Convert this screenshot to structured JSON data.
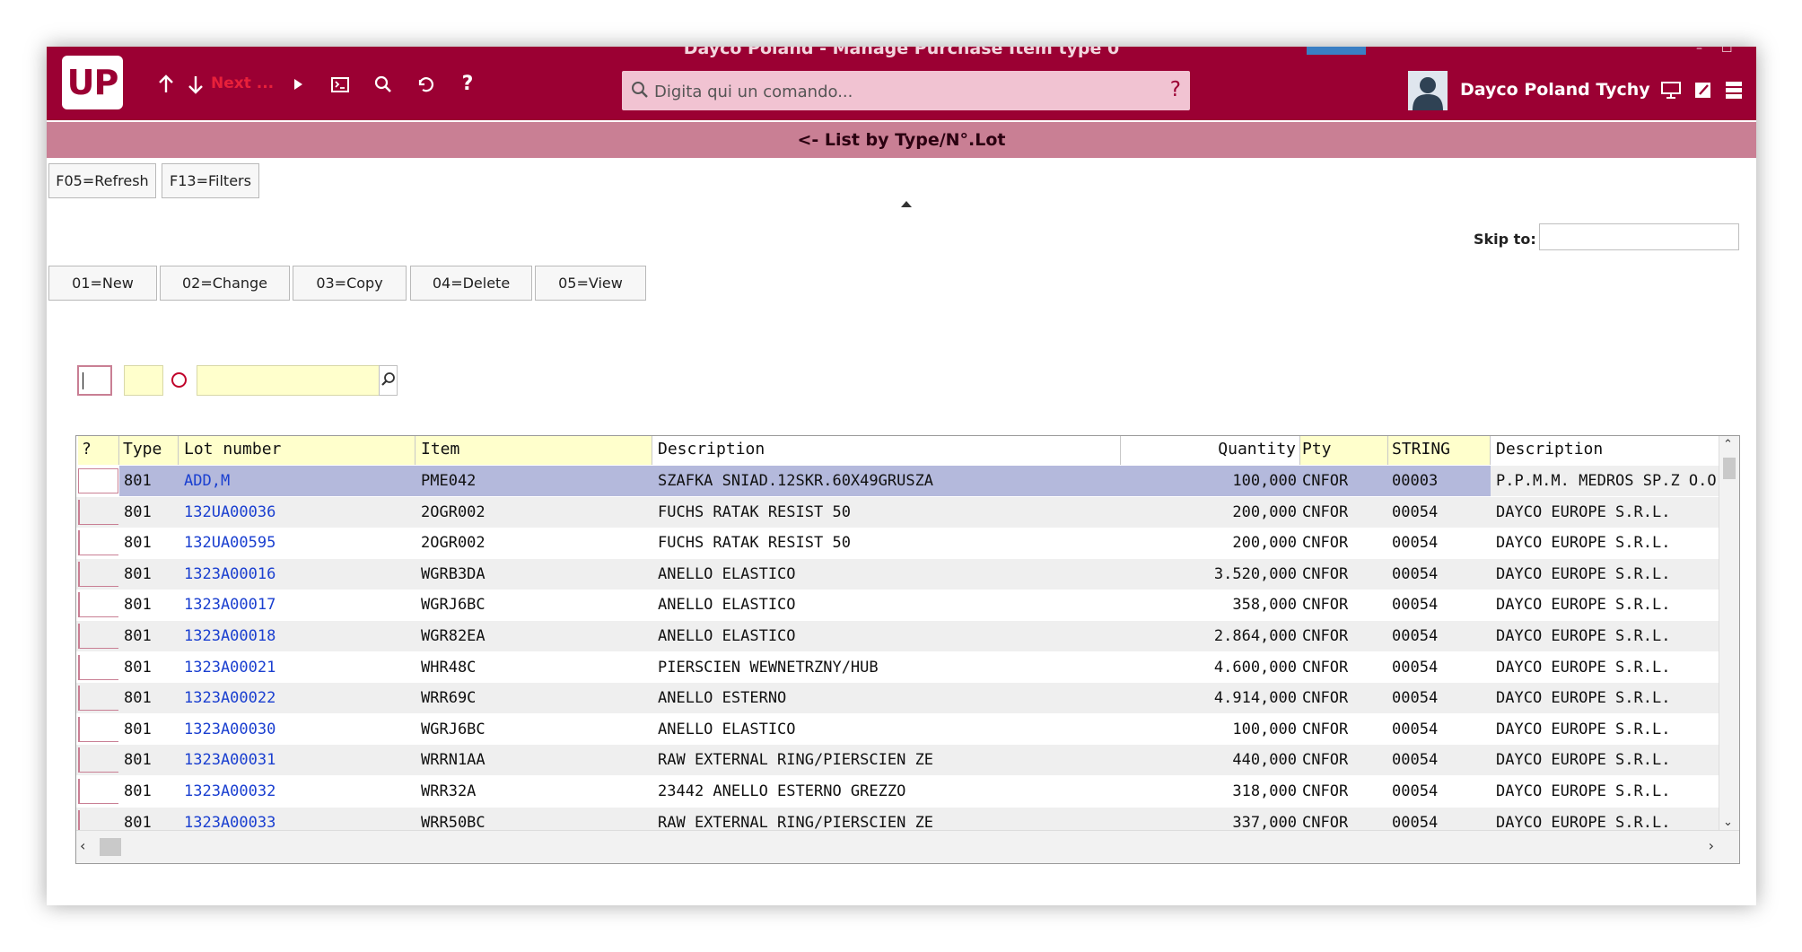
{
  "window": {
    "title": "Dayco Poland - Manage Purchase Item type 0",
    "controls": [
      "–",
      "☐"
    ]
  },
  "toolbar": {
    "logo_text": "UP",
    "next_label": "Next ...",
    "command": {
      "placeholder": "Digita qui un comando...",
      "help": "?"
    },
    "user_name": "Dayco Poland Tychy",
    "icons": [
      "arrow-up-icon",
      "arrow-down-icon",
      "play-icon",
      "terminal-icon",
      "search-icon",
      "undo-icon",
      "help-icon",
      "monitor-icon",
      "edit-icon",
      "menu-icon"
    ]
  },
  "banner": {
    "title": "<- List by Type/N°.Lot"
  },
  "fkeys": {
    "refresh": "F05=Refresh",
    "filters": "F13=Filters"
  },
  "skip": {
    "label": "Skip to:"
  },
  "actions": {
    "new": "01=New",
    "change": "02=Change",
    "copy": "03=Copy",
    "delete": "04=Delete",
    "view": "05=View"
  },
  "grid": {
    "columns": [
      "?",
      "Type",
      "Lot number",
      "Item",
      "Description",
      "Quantity",
      "Pty",
      "STRING",
      "Description"
    ],
    "rows": [
      {
        "type": "801",
        "lot": "ADD,M",
        "item": "PME042",
        "desc": "SZAFKA SNIAD.12SKR.60X49GRUSZA",
        "qty": "100,000",
        "pty": "CNFOR",
        "str": "00003",
        "desc2": "P.P.M.M. MEDROS SP.Z O.O."
      },
      {
        "type": "801",
        "lot": "132UA00036",
        "item": "2OGR002",
        "desc": "FUCHS RATAK RESIST 50",
        "qty": "200,000",
        "pty": "CNFOR",
        "str": "00054",
        "desc2": "DAYCO EUROPE S.R.L."
      },
      {
        "type": "801",
        "lot": "132UA00595",
        "item": "2OGR002",
        "desc": "FUCHS RATAK RESIST 50",
        "qty": "200,000",
        "pty": "CNFOR",
        "str": "00054",
        "desc2": "DAYCO EUROPE S.R.L."
      },
      {
        "type": "801",
        "lot": "1323A00016",
        "item": "WGRB3DA",
        "desc": "ANELLO ELASTICO",
        "qty": "3.520,000",
        "pty": "CNFOR",
        "str": "00054",
        "desc2": "DAYCO EUROPE S.R.L."
      },
      {
        "type": "801",
        "lot": "1323A00017",
        "item": "WGRJ6BC",
        "desc": "ANELLO ELASTICO",
        "qty": "358,000",
        "pty": "CNFOR",
        "str": "00054",
        "desc2": "DAYCO EUROPE S.R.L."
      },
      {
        "type": "801",
        "lot": "1323A00018",
        "item": "WGR82EA",
        "desc": "ANELLO ELASTICO",
        "qty": "2.864,000",
        "pty": "CNFOR",
        "str": "00054",
        "desc2": "DAYCO EUROPE S.R.L."
      },
      {
        "type": "801",
        "lot": "1323A00021",
        "item": "WHR48C",
        "desc": "PIERSCIEN WEWNETRZNY/HUB",
        "qty": "4.600,000",
        "pty": "CNFOR",
        "str": "00054",
        "desc2": "DAYCO EUROPE S.R.L."
      },
      {
        "type": "801",
        "lot": "1323A00022",
        "item": "WRR69C",
        "desc": "ANELLO ESTERNO",
        "qty": "4.914,000",
        "pty": "CNFOR",
        "str": "00054",
        "desc2": "DAYCO EUROPE S.R.L."
      },
      {
        "type": "801",
        "lot": "1323A00030",
        "item": "WGRJ6BC",
        "desc": "ANELLO ELASTICO",
        "qty": "100,000",
        "pty": "CNFOR",
        "str": "00054",
        "desc2": "DAYCO EUROPE S.R.L."
      },
      {
        "type": "801",
        "lot": "1323A00031",
        "item": "WRRN1AA",
        "desc": "RAW EXTERNAL RING/PIERSCIEN ZE",
        "qty": "440,000",
        "pty": "CNFOR",
        "str": "00054",
        "desc2": "DAYCO EUROPE S.R.L."
      },
      {
        "type": "801",
        "lot": "1323A00032",
        "item": "WRR32A",
        "desc": "23442 ANELLO ESTERNO GREZZO",
        "qty": "318,000",
        "pty": "CNFOR",
        "str": "00054",
        "desc2": "DAYCO EUROPE S.R.L."
      },
      {
        "type": "801",
        "lot": "1323A00033",
        "item": "WRR50BC",
        "desc": "RAW EXTERNAL RING/PIERSCIEN ZE",
        "qty": "337,000",
        "pty": "CNFOR",
        "str": "00054",
        "desc2": "DAYCO EUROPE S.R.L."
      }
    ]
  },
  "colors": {
    "topbar": "#9b0033",
    "banner": "#c97f94",
    "selected_row": "#b4b9dc",
    "alt_row": "#efefef",
    "lot_link": "#1a3fd0",
    "filter_bg": "#ffffcc"
  }
}
